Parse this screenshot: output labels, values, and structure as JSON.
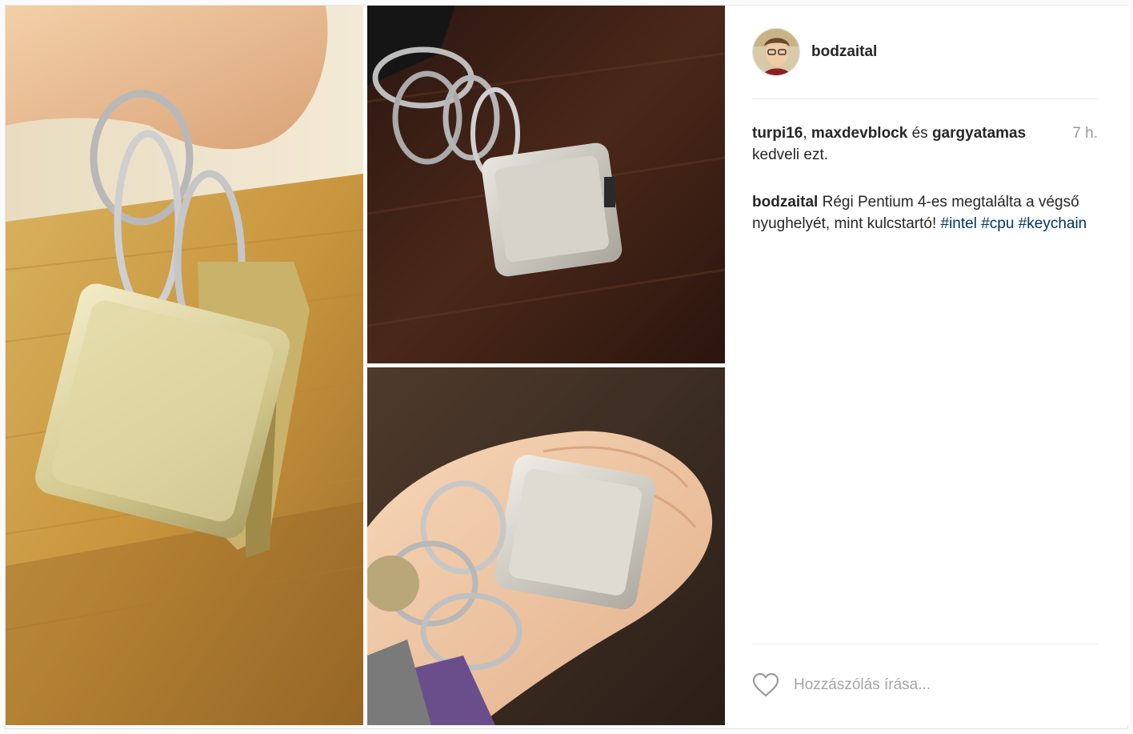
{
  "post": {
    "author": "bodzaital",
    "likes": {
      "users": [
        "turpi16",
        "maxdevblock",
        "gargyatamas"
      ],
      "separator": ", ",
      "conjunction": " és ",
      "suffix": "kedveli ezt.",
      "time": "7 h."
    },
    "caption": {
      "user": "bodzaital",
      "text": " Régi Pentium 4-es megtalálta a végső nyughelyét, mint kulcstartó! ",
      "tags": [
        "#intel",
        "#cpu",
        "#keychain"
      ]
    },
    "comment_placeholder": "Hozzászólás írása..."
  },
  "colors": {
    "text": "#262626",
    "hashtag": "#003569",
    "muted": "#999999",
    "divider": "#efefef"
  },
  "icons": {
    "like": "heart-outline-icon"
  },
  "images": [
    "hand-holding-cpu-keychain-photo",
    "cpu-keychain-on-table-photo",
    "cpu-keychain-in-palm-photo"
  ]
}
